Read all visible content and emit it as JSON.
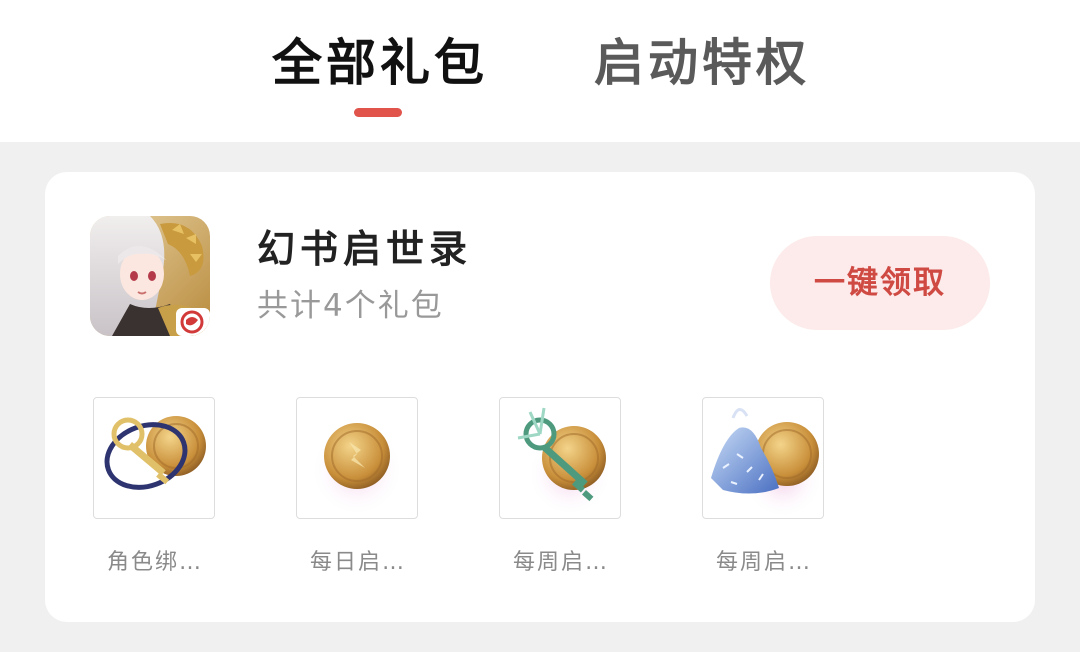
{
  "tabs": [
    {
      "label": "全部礼包",
      "active": true
    },
    {
      "label": "启动特权",
      "active": false
    }
  ],
  "accent_color": "#e0544c",
  "game": {
    "title": "幻书启世录",
    "subtitle": "共计4个礼包",
    "icon": "game-app-icon"
  },
  "claim_button": {
    "label": "一键领取",
    "text_color": "#d04a44",
    "bg_color": "#fcebea"
  },
  "gifts": [
    {
      "label": "角色绑…",
      "icon": "key-and-coin-icon"
    },
    {
      "label": "每日启…",
      "icon": "gold-coin-icon"
    },
    {
      "label": "每周启…",
      "icon": "green-key-and-coin-icon"
    },
    {
      "label": "每周启…",
      "icon": "blue-crystal-and-coin-icon"
    }
  ]
}
